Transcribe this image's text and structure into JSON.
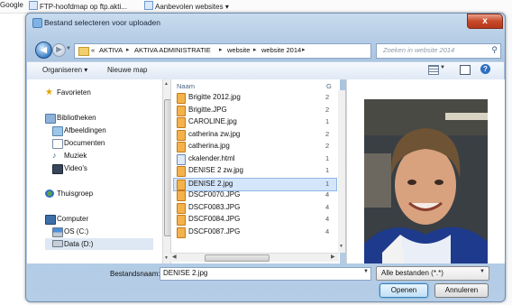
{
  "browser": {
    "bookmarks": [
      "Google",
      "FTP-hoofdmap op ftp.akti...",
      "Aanbevolen websites ▾"
    ]
  },
  "dialog": {
    "title": "Bestand selecteren voor uploaden",
    "close_label": "x",
    "address": {
      "overflow": "«",
      "crumbs": [
        "AKTIVA",
        "AKTIVA ADMINISTRATIE",
        "website",
        "website 2014"
      ],
      "separator": "▸"
    },
    "search_placeholder": "Zoeken in website 2014",
    "toolbar": {
      "organize_label": "Organiseren ▾",
      "new_folder_label": "Nieuwe map"
    },
    "nav": {
      "favorites": "Favorieten",
      "libraries": "Bibliotheken",
      "library_items": [
        "Afbeeldingen",
        "Documenten",
        "Muziek",
        "Video's"
      ],
      "homegroup": "Thuisgroep",
      "computer": "Computer",
      "drives": [
        "OS (C:)",
        "Data (D:)"
      ]
    },
    "files": {
      "column_name": "Naam",
      "column_g": "G",
      "rows": [
        {
          "name": "Brigitte 2012.jpg",
          "side": "2",
          "type": "jpg",
          "selected": false
        },
        {
          "name": "Brigitte.JPG",
          "side": "2",
          "type": "jpg",
          "selected": false
        },
        {
          "name": "CAROLINE.jpg",
          "side": "1",
          "type": "jpg",
          "selected": false
        },
        {
          "name": "catherina zw.jpg",
          "side": "2",
          "type": "jpg",
          "selected": false
        },
        {
          "name": "catherina.jpg",
          "side": "2",
          "type": "jpg",
          "selected": false
        },
        {
          "name": "ckalender.html",
          "side": "1",
          "type": "html",
          "selected": false
        },
        {
          "name": "DENISE 2 zw.jpg",
          "side": "1",
          "type": "jpg",
          "selected": false
        },
        {
          "name": "DENISE 2.jpg",
          "side": "1",
          "type": "jpg",
          "selected": true
        },
        {
          "name": "DSCF0070.JPG",
          "side": "4",
          "type": "jpg",
          "selected": false
        },
        {
          "name": "DSCF0083.JPG",
          "side": "4",
          "type": "jpg",
          "selected": false
        },
        {
          "name": "DSCF0084.JPG",
          "side": "4",
          "type": "jpg",
          "selected": false
        },
        {
          "name": "DSCF0087.JPG",
          "side": "4",
          "type": "jpg",
          "selected": false
        }
      ]
    },
    "filename_label": "Bestandsnaam:",
    "filename_value": "DENISE 2.jpg",
    "filetype_value": "Alle bestanden (*.*)",
    "open_label": "Openen",
    "cancel_label": "Annuleren"
  }
}
